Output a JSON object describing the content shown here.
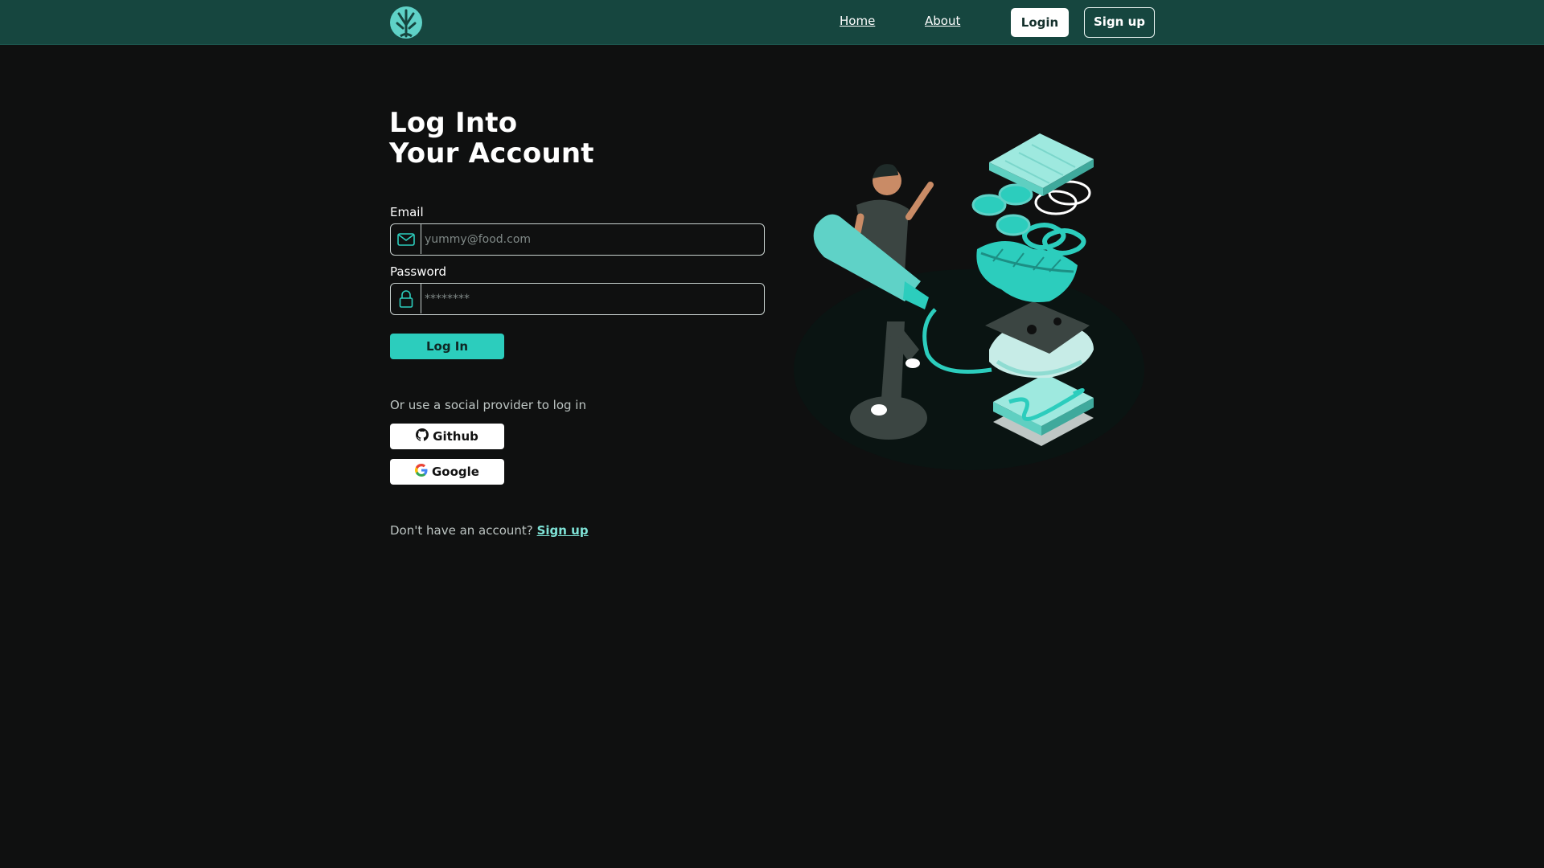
{
  "navbar": {
    "logo_icon": "tree-icon",
    "links": [
      {
        "label": "Home"
      },
      {
        "label": "About"
      }
    ],
    "login_label": "Login",
    "signup_label": "Sign up"
  },
  "page": {
    "title_line1": "Log Into",
    "title_line2": "Your Account"
  },
  "form": {
    "email_label": "Email",
    "email_placeholder": "yummy@food.com",
    "email_icon": "envelope-icon",
    "password_label": "Password",
    "password_placeholder": "********",
    "password_icon": "lock-icon",
    "submit_label": "Log In"
  },
  "social": {
    "prompt": "Or use a social provider to log in",
    "github_label": "Github",
    "github_icon": "github-icon",
    "google_label": "Google",
    "google_icon": "google-icon"
  },
  "footer": {
    "prompt": "Don't have an account?",
    "signup_link": "Sign up"
  },
  "colors": {
    "navbar_bg": "#16463f",
    "page_bg": "#0f1010",
    "accent": "#2ccdbd",
    "link": "#7fe3d7"
  }
}
